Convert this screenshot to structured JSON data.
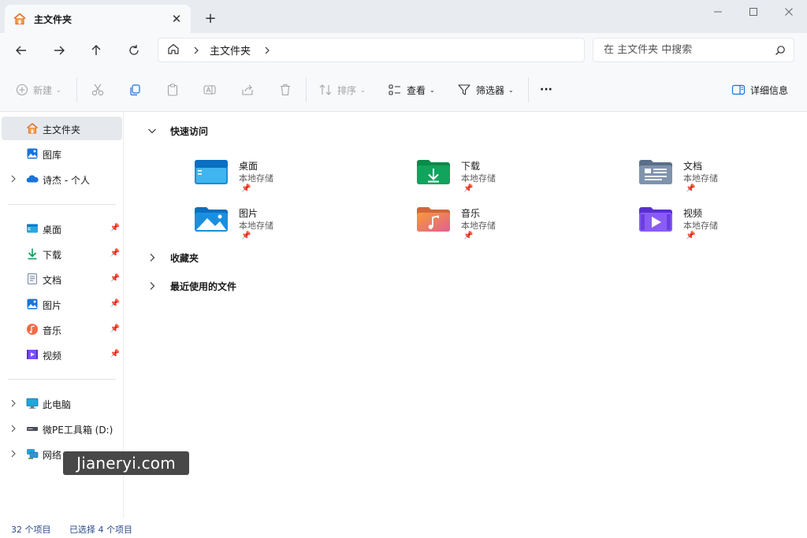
{
  "tab": {
    "title": "主文件夹"
  },
  "window_controls": {
    "minimize": "—",
    "maximize": "☐",
    "close": "✕"
  },
  "address": {
    "crumbs": [
      "主文件夹"
    ]
  },
  "search": {
    "placeholder": "在 主文件夹 中搜索"
  },
  "commands": {
    "new": "新建",
    "sort": "排序",
    "view": "查看",
    "filter": "筛选器",
    "more": "···",
    "details": "详细信息"
  },
  "sidebar": {
    "top": [
      {
        "label": "主文件夹",
        "icon": "home-icon",
        "active": true
      },
      {
        "label": "图库",
        "icon": "gallery-icon"
      },
      {
        "label": "诗杰 - 个人",
        "icon": "onedrive-icon",
        "expandable": true
      }
    ],
    "pinned": [
      {
        "label": "桌面",
        "icon": "desktop-icon"
      },
      {
        "label": "下载",
        "icon": "download-icon"
      },
      {
        "label": "文档",
        "icon": "documents-icon"
      },
      {
        "label": "图片",
        "icon": "pictures-icon"
      },
      {
        "label": "音乐",
        "icon": "music-icon"
      },
      {
        "label": "视频",
        "icon": "videos-icon"
      }
    ],
    "devices": [
      {
        "label": "此电脑",
        "icon": "this-pc-icon"
      },
      {
        "label": "微PE工具箱 (D:)",
        "icon": "drive-icon"
      },
      {
        "label": "网络",
        "icon": "network-icon"
      }
    ]
  },
  "main": {
    "sections": [
      "快速访问",
      "收藏夹",
      "最近使用的文件"
    ],
    "quick_access": [
      {
        "name": "桌面",
        "sub": "本地存储",
        "icon": "desktop-folder-icon"
      },
      {
        "name": "下载",
        "sub": "本地存储",
        "icon": "downloads-folder-icon"
      },
      {
        "name": "文档",
        "sub": "本地存储",
        "icon": "documents-folder-icon"
      },
      {
        "name": "图片",
        "sub": "本地存储",
        "icon": "pictures-folder-icon"
      },
      {
        "name": "音乐",
        "sub": "本地存储",
        "icon": "music-folder-icon"
      },
      {
        "name": "视频",
        "sub": "本地存储",
        "icon": "videos-folder-icon"
      }
    ]
  },
  "status": {
    "items": "32 个项目",
    "selected": "已选择 4 个项目"
  },
  "watermark": "Jianeryi.com",
  "colors": {
    "accent": "#0067c0",
    "folder_blue": "#1e88e5",
    "download_green": "#0f9d58",
    "video_purple": "#7c4dff"
  }
}
